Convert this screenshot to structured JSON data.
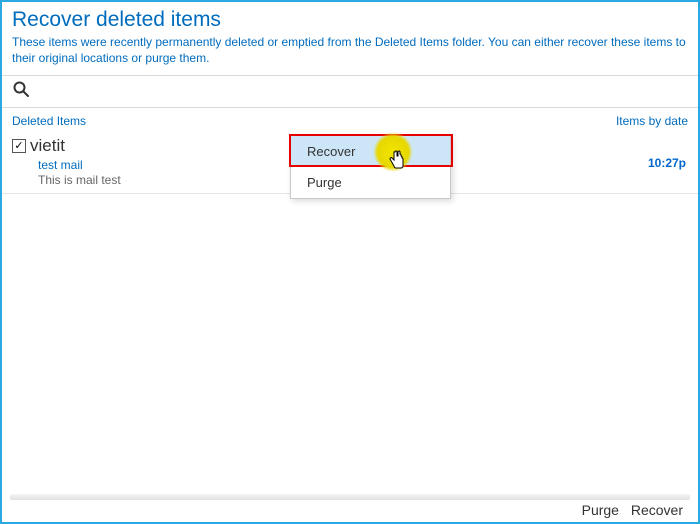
{
  "header": {
    "title": "Recover deleted items",
    "desc": "These items were recently permanently deleted or emptied from the Deleted Items folder. You can either recover these items to their original locations or purge them."
  },
  "meta": {
    "left": "Deleted Items",
    "right": "Items by date"
  },
  "item": {
    "sender": "vietit",
    "subject": "test mail",
    "preview": "This is mail test",
    "time": "10:27p",
    "check": "✓"
  },
  "menu": {
    "recover": "Recover",
    "purge": "Purge"
  },
  "footer": {
    "purge": "Purge",
    "recover": "Recover"
  }
}
